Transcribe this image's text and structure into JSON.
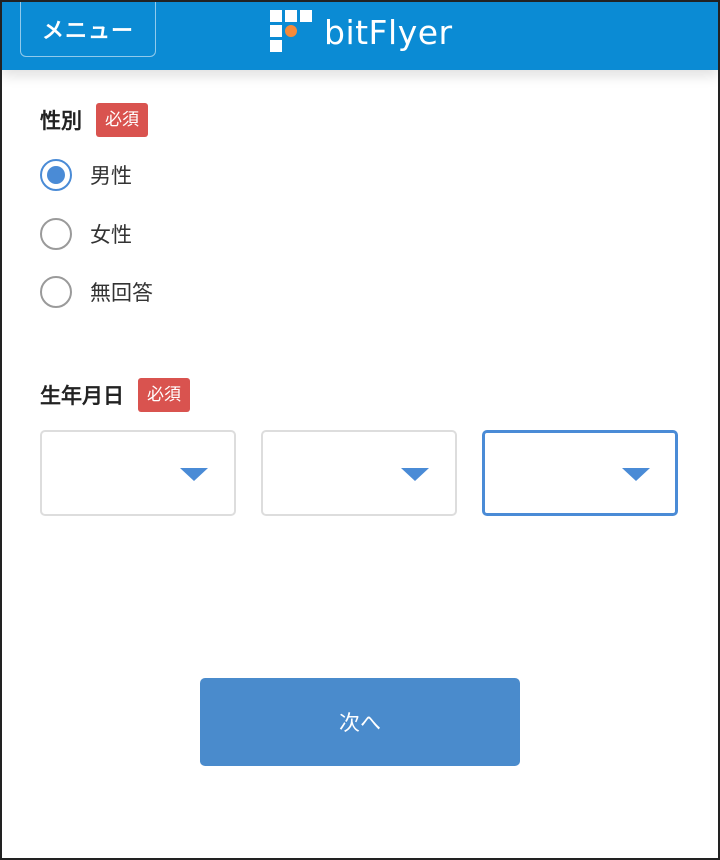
{
  "header": {
    "menu_label": "メニュー",
    "logo_text": "bitFlyer",
    "logo_icon": "bitflyer-logo-icon",
    "background_color": "#0b8bd4",
    "logo_dot_color": "#f58a3a"
  },
  "gender": {
    "label": "性別",
    "required_badge": "必須",
    "options": [
      {
        "label": "男性",
        "checked": true
      },
      {
        "label": "女性",
        "checked": false
      },
      {
        "label": "無回答",
        "checked": false
      }
    ]
  },
  "birthdate": {
    "label": "生年月日",
    "required_badge": "必須",
    "selects": [
      {
        "value": "",
        "focused": false,
        "icon": "dropdown-arrow-icon"
      },
      {
        "value": "",
        "focused": false,
        "icon": "dropdown-arrow-icon"
      },
      {
        "value": "",
        "focused": true,
        "icon": "dropdown-arrow-icon"
      }
    ]
  },
  "actions": {
    "next_label": "次へ"
  },
  "colors": {
    "accent": "#4a8bd6",
    "required": "#d9534f",
    "button": "#4a8bcc"
  }
}
